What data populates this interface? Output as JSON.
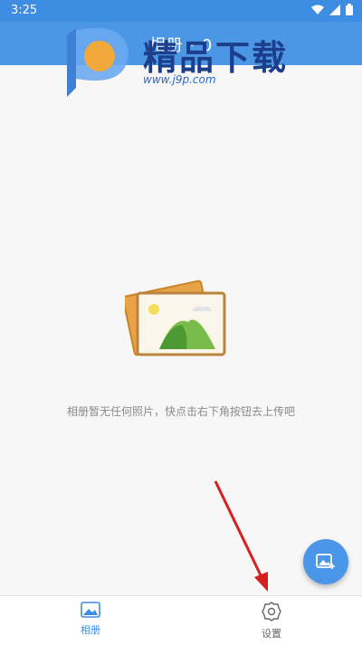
{
  "status_bar": {
    "time": "3:25",
    "icons": [
      "wifi-icon",
      "signal-icon",
      "battery-icon"
    ]
  },
  "app_bar": {
    "title": "相册 · 0"
  },
  "watermark": {
    "brand": "精品下载",
    "url": "www.j9p.com"
  },
  "empty_state": {
    "illustration": "photo-stack-icon",
    "message": "相册暂无任何照片，快点击右下角按钮去上传吧"
  },
  "fab": {
    "icon": "add-photo-icon"
  },
  "bottom_nav": {
    "items": [
      {
        "label": "相册",
        "icon": "image-icon",
        "active": true
      },
      {
        "label": "设置",
        "icon": "gear-icon",
        "active": false
      }
    ]
  },
  "colors": {
    "primary": "#4c96e6",
    "status_bar": "#3d8de2",
    "annotation_arrow": "#d6201f",
    "text_muted": "#8a8a8a"
  }
}
